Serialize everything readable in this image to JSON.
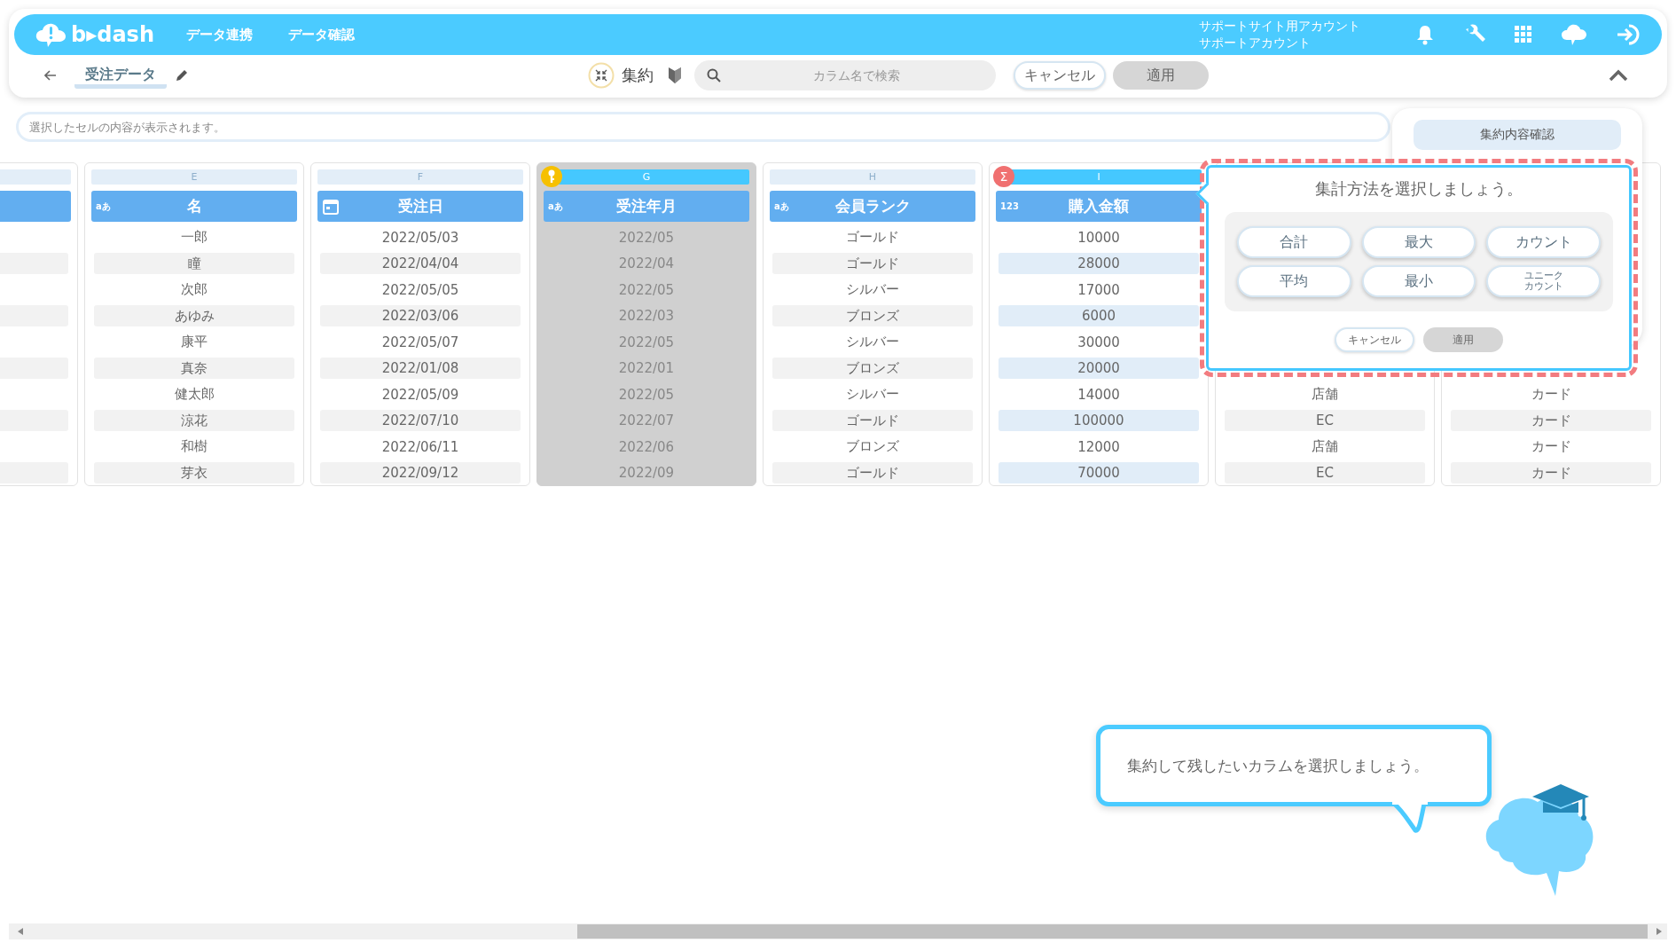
{
  "header": {
    "logo": "b▸dash",
    "nav": [
      {
        "label": "データ連携"
      },
      {
        "label": "データ確認"
      }
    ],
    "account": [
      "サポートサイト用アカウント",
      "サポートアカウント"
    ]
  },
  "toolbar": {
    "title": "受注データ",
    "mode": "集約",
    "search": {
      "placeholder": "カラム名で検索"
    },
    "buttons": [
      {
        "label": "キャンセル",
        "disabled": false
      },
      {
        "label": "適用",
        "disabled": true
      }
    ]
  },
  "cell_viewer": {
    "placeholder": "選択したセルの内容が表示されます。"
  },
  "summary_panel": {
    "button": "集約内容確認"
  },
  "columns": [
    {
      "selected": false,
      "marked": false
    },
    {
      "letter": "E",
      "kind": "text",
      "type_label": "aあ",
      "title": "名",
      "selected": false,
      "marked": false,
      "values": [
        "一郎",
        "瞳",
        "次郎",
        "あゆみ",
        "康平",
        "真奈",
        "健太郎",
        "涼花",
        "和樹",
        "芽衣"
      ]
    },
    {
      "letter": "F",
      "kind": "date",
      "title": "受注日",
      "selected": false,
      "marked": false,
      "values": [
        "2022/05/03",
        "2022/04/04",
        "2022/05/05",
        "2022/03/06",
        "2022/05/07",
        "2022/01/08",
        "2022/05/09",
        "2022/07/10",
        "2022/06/11",
        "2022/09/12"
      ]
    },
    {
      "letter": "G",
      "kind": "text",
      "type_label": "aあ",
      "title": "受注年月",
      "selected": true,
      "marked": true,
      "badge": {
        "kind": "key"
      },
      "values": [
        "2022/05",
        "2022/04",
        "2022/05",
        "2022/03",
        "2022/05",
        "2022/01",
        "2022/05",
        "2022/07",
        "2022/06",
        "2022/09"
      ]
    },
    {
      "letter": "H",
      "kind": "text",
      "type_label": "aあ",
      "title": "会員ランク",
      "selected": false,
      "marked": false,
      "values": [
        "ゴールド",
        "ゴールド",
        "シルバー",
        "ブロンズ",
        "シルバー",
        "ブロンズ",
        "シルバー",
        "ゴールド",
        "ブロンズ",
        "ゴールド"
      ]
    },
    {
      "letter": "I",
      "kind": "number",
      "type_label": "123",
      "title": "購入金額",
      "selected": false,
      "marked": true,
      "badge": {
        "kind": "sum",
        "label": "Σ"
      },
      "values": [
        "10000",
        "28000",
        "17000",
        "6000",
        "30000",
        "20000",
        "14000",
        "100000",
        "12000",
        "70000"
      ]
    },
    {
      "selected": false,
      "values": [
        "店舗",
        "EC",
        "店舗",
        "EC"
      ]
    },
    {
      "selected": false,
      "values": [
        "カード",
        "カード",
        "カード",
        "カード"
      ]
    }
  ],
  "aggregate_popup": {
    "title": "集計方法を選択しましょう。",
    "methods": [
      {
        "label": "合計"
      },
      {
        "label": "最大"
      },
      {
        "label": "カウント"
      },
      {
        "label": "平均"
      },
      {
        "label": "最小"
      },
      {
        "lines": [
          "ユニーク",
          "カウント"
        ]
      }
    ],
    "buttons": [
      {
        "label": "キャンセル",
        "disabled": false
      },
      {
        "label": "適用",
        "disabled": true
      }
    ]
  },
  "guide": {
    "message": "集約して残したいカラムを選択しましょう。"
  }
}
